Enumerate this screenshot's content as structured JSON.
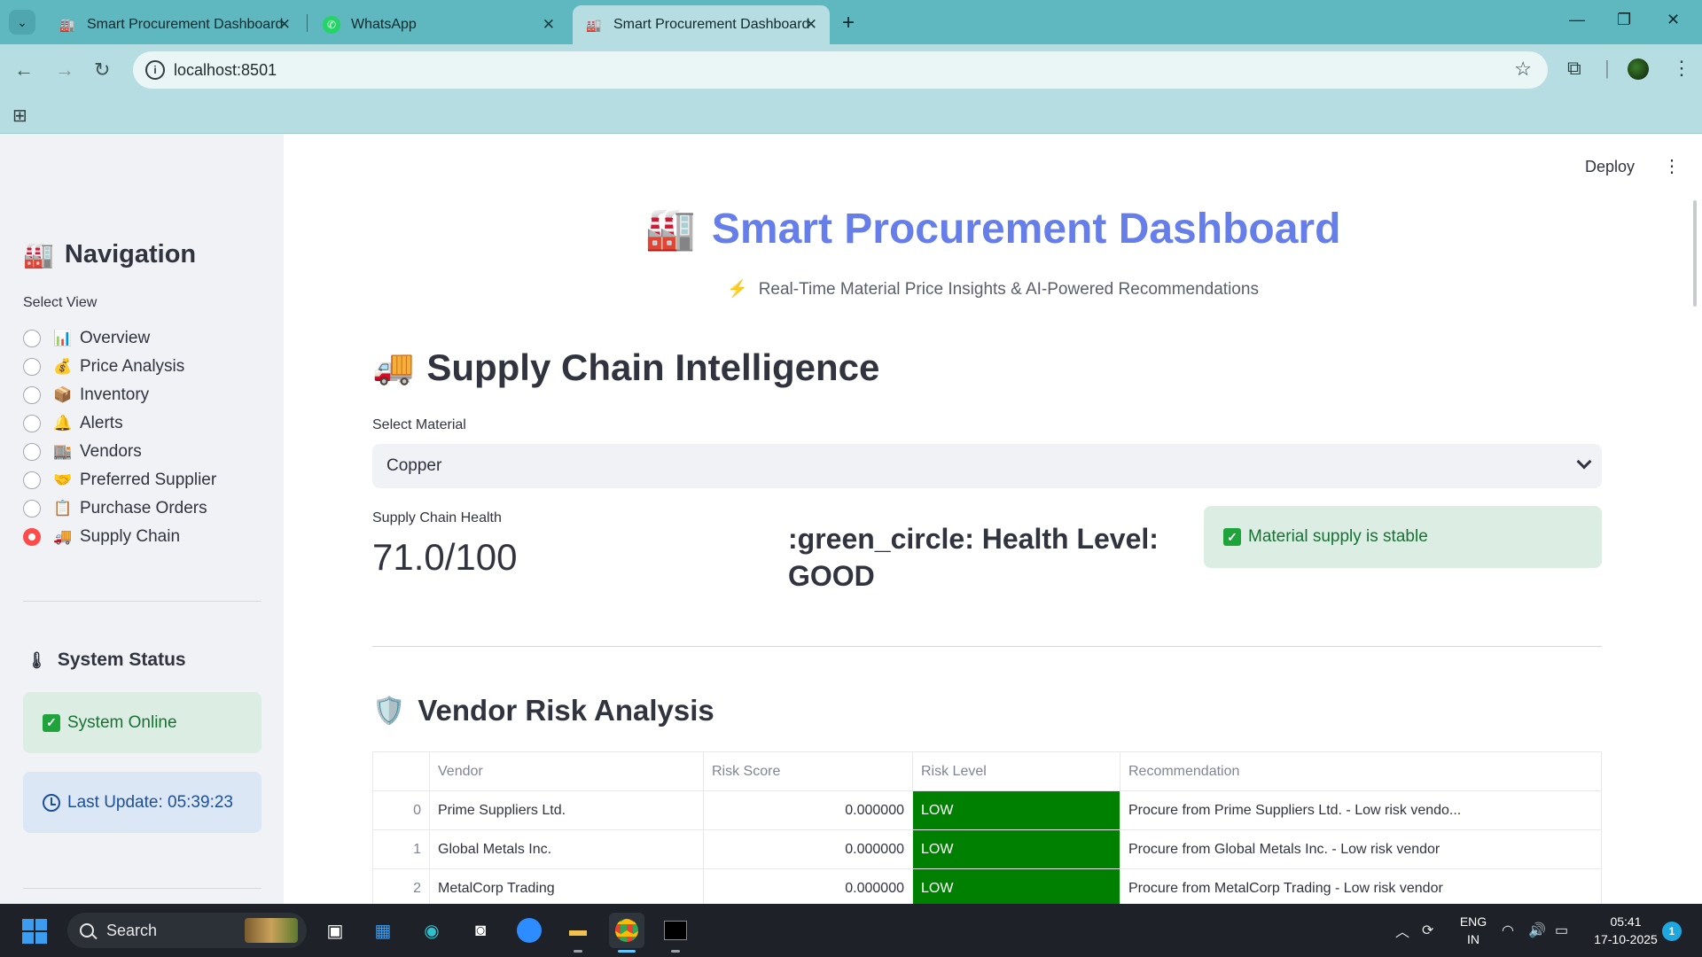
{
  "browser": {
    "tabs": [
      {
        "title": "Smart Procurement Dashboard",
        "favicon": "factory-icon",
        "active": false
      },
      {
        "title": "WhatsApp",
        "favicon": "whatsapp-icon",
        "active": false
      },
      {
        "title": "Smart Procurement Dashboard",
        "favicon": "factory-icon",
        "active": true
      }
    ],
    "url": "localhost:8501",
    "colors": {
      "tabbar": "#5fb8c0",
      "toolbar": "#b6dee2"
    }
  },
  "sidebar": {
    "nav_title": "Navigation",
    "nav_emoji": "🏭",
    "select_label": "Select View",
    "items": [
      {
        "emoji": "📊",
        "label": "Overview",
        "selected": false
      },
      {
        "emoji": "💰",
        "label": "Price Analysis",
        "selected": false
      },
      {
        "emoji": "📦",
        "label": "Inventory",
        "selected": false
      },
      {
        "emoji": "🔔",
        "label": "Alerts",
        "selected": false
      },
      {
        "emoji": "🏬",
        "label": "Vendors",
        "selected": false
      },
      {
        "emoji": "🤝",
        "label": "Preferred Supplier",
        "selected": false
      },
      {
        "emoji": "📋",
        "label": "Purchase Orders",
        "selected": false
      },
      {
        "emoji": "🚚",
        "label": "Supply Chain",
        "selected": true
      }
    ],
    "status_title": "System Status",
    "status_emoji": "🌡",
    "online_text": "System Online",
    "last_update": "Last Update: 05:39:23"
  },
  "main": {
    "deploy_label": "Deploy",
    "title": "Smart Procurement Dashboard",
    "title_emoji": "🏭",
    "subtitle": "Real-Time Material Price Insights & AI-Powered Recommendations",
    "subtitle_emoji": "⚡",
    "section1_title": "Supply Chain Intelligence",
    "section1_emoji": "🚚",
    "material_label": "Select Material",
    "material_value": "Copper",
    "health_metric_label": "Supply Chain Health",
    "health_metric_value": "71.0/100",
    "health_level_text": ":green_circle: Health Level: GOOD",
    "stable_text": "Material supply is stable",
    "section2_title": "Vendor Risk Analysis",
    "section2_emoji": "🛡️",
    "table": {
      "columns": [
        "",
        "Vendor",
        "Risk Score",
        "Risk Level",
        "Recommendation"
      ],
      "rows": [
        {
          "index": "0",
          "vendor": "Prime Suppliers Ltd.",
          "score": "0.000000",
          "level": "LOW",
          "recommendation": "Procure from Prime Suppliers Ltd. - Low risk vendo..."
        },
        {
          "index": "1",
          "vendor": "Global Metals Inc.",
          "score": "0.000000",
          "level": "LOW",
          "recommendation": "Procure from Global Metals Inc. - Low risk vendor"
        },
        {
          "index": "2",
          "vendor": "MetalCorp Trading",
          "score": "0.000000",
          "level": "LOW",
          "recommendation": "Procure from MetalCorp Trading - Low risk vendor"
        }
      ]
    },
    "colors": {
      "title": "#667eea",
      "risk_low": "#008000",
      "radio_selected": "#ff4b4b"
    }
  },
  "taskbar": {
    "search_label": "Search",
    "lang_top": "ENG",
    "lang_bottom": "IN",
    "time": "05:41",
    "date": "17-10-2025",
    "notification_count": "1"
  }
}
